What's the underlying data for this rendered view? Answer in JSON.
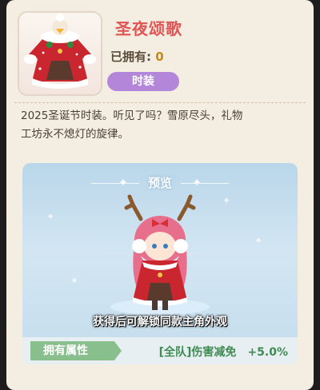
{
  "item": {
    "title": "圣夜颂歌",
    "owned_label": "已拥有: ",
    "owned_count": "0",
    "tag": "时装",
    "description_lines": [
      "2025圣诞节时装。听见了吗？雪原尽头，礼物",
      "工坊永不熄灯的旋律。"
    ]
  },
  "preview": {
    "title": "预览",
    "caption": "获得后可解锁同款主角外观"
  },
  "attribute": {
    "label": "拥有属性",
    "name": "[全队]伤害减免",
    "value": "+5.0%"
  },
  "colors": {
    "title": "#e05454",
    "tag_bg": "#b386da",
    "attribute_green": "#3f8c52",
    "attribute_label_bg": "#88bf8d"
  }
}
